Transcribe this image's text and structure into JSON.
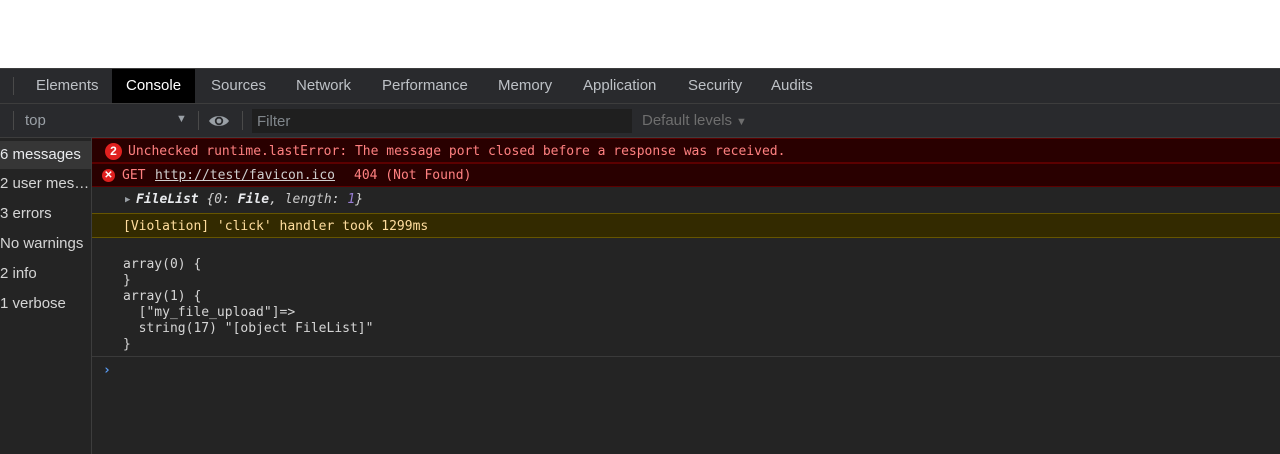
{
  "tabs": [
    {
      "label": "Elements",
      "active": false
    },
    {
      "label": "Console",
      "active": true
    },
    {
      "label": "Sources",
      "active": false
    },
    {
      "label": "Network",
      "active": false
    },
    {
      "label": "Performance",
      "active": false
    },
    {
      "label": "Memory",
      "active": false
    },
    {
      "label": "Application",
      "active": false
    },
    {
      "label": "Security",
      "active": false
    },
    {
      "label": "Audits",
      "active": false
    }
  ],
  "toolbar": {
    "context": "top",
    "context_arrow": "▼",
    "filter_placeholder": "Filter",
    "levels": "Default levels",
    "levels_arrow": "▼"
  },
  "sidebar": {
    "items": [
      "6 messages",
      "2 user mes…",
      "3 errors",
      "No warnings",
      "2 info",
      "1 verbose"
    ]
  },
  "console": {
    "messages": {
      "error1": {
        "count": "2",
        "text": "Unchecked runtime.lastError: The message port closed before a response was received."
      },
      "error2": {
        "icon": "✕",
        "method": "GET",
        "url": "http://test/favicon.ico",
        "status": "404 (Not Found)"
      },
      "filelist": {
        "name": "FileList",
        "open": "{",
        "k0": "0",
        "v0": "File",
        "k1": "length",
        "v1": "1",
        "close": "}"
      },
      "violation": "[Violation] 'click' handler took 1299ms",
      "php_dump": [
        "array(0) {",
        "}",
        "array(1) {",
        "  [\"my_file_upload\"]=>",
        "  string(17) \"[object FileList]\"",
        "}"
      ]
    },
    "prompt": "›"
  },
  "colors": {
    "error_bg": "#290000",
    "error_text": "#ff8080",
    "warn_bg": "#332a00",
    "warn_text": "#ffdd9e",
    "active_tab": "#000000",
    "prompt": "#5a9cf5"
  }
}
